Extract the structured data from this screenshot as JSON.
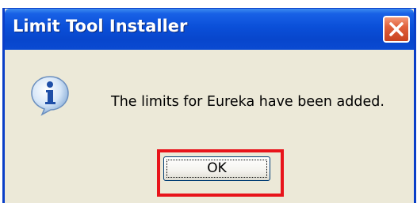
{
  "dialog": {
    "title": "Limit Tool Installer",
    "message": "The limits for Eureka have been added.",
    "ok_label": "OK",
    "icons": {
      "close": "close-icon",
      "info": "info-icon"
    }
  },
  "colors": {
    "titlebar": "#0a4fd8",
    "dialog_background": "#ece9d8",
    "close_button": "#e0603b",
    "highlight": "#e8141b"
  }
}
